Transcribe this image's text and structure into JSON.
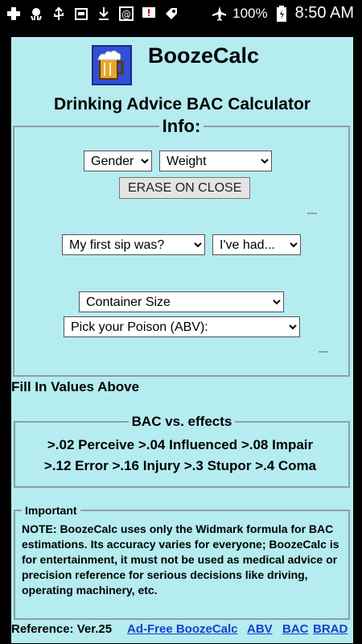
{
  "status_bar": {
    "battery_percent": "100%",
    "time": "8:50 AM"
  },
  "app": {
    "title": "BoozeCalc",
    "subtitle": "Drinking Advice BAC Calculator"
  },
  "info": {
    "legend": "Info:",
    "gender_select": "Gender",
    "weight_select": "Weight",
    "erase_button": "ERASE ON CLOSE",
    "dash1": "---",
    "first_sip_select": "My first sip was?",
    "ive_had_select": "I've had...",
    "container_select": "Container Size",
    "poison_select": "Pick your Poison (ABV):",
    "dash2": "---"
  },
  "fill_text": "Fill In Values Above",
  "bac": {
    "legend": "BAC vs. effects",
    "line1": ">.02 Perceive >.04 Influenced >.08 Impair",
    "line2": ">.12 Error >.16 Injury >.3 Stupor >.4 Coma"
  },
  "important": {
    "legend": "Important",
    "note": "NOTE: BoozeCalc uses only the Widmark formula for BAC estimations. Its accuracy varies for everyone; BoozeCalc is for entertainment, it must not be used as medical advice or precision reference for serious decisions like driving, operating machinery, etc."
  },
  "footer": {
    "reference": "Reference: Ver.25",
    "link_adfree": "Ad-Free BoozeCalc",
    "link_abv": "ABV",
    "link_bac": "BAC",
    "link_brad": "BRAD"
  }
}
